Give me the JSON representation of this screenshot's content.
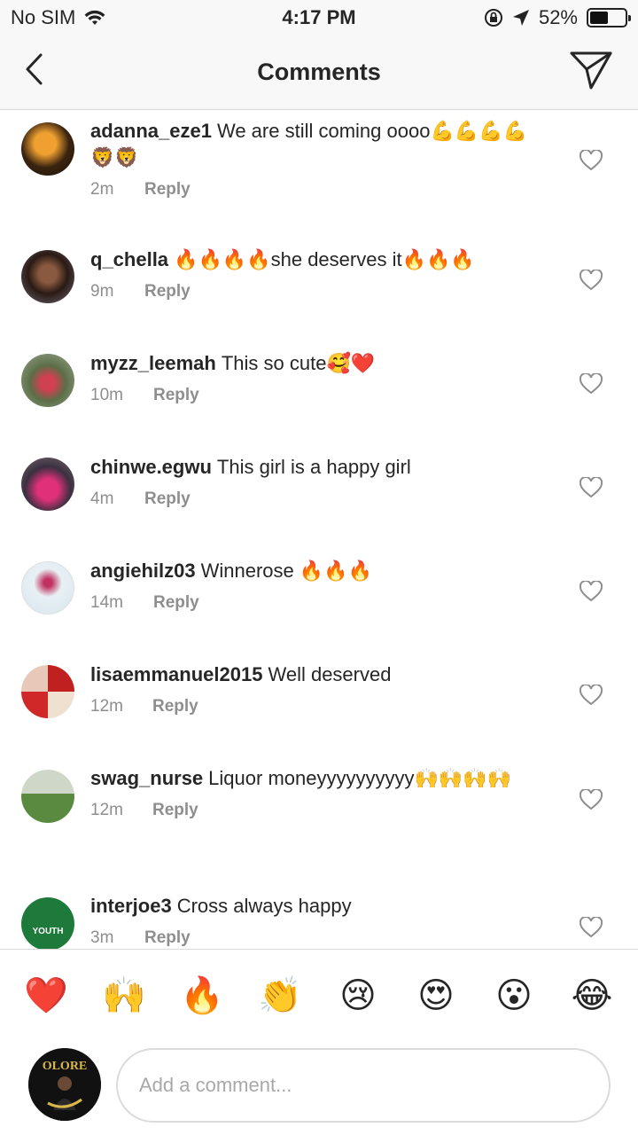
{
  "status_bar": {
    "carrier": "No SIM",
    "time": "4:17 PM",
    "battery_pct": "52%",
    "battery_level": 0.52,
    "icons": [
      "wifi-icon",
      "orientation-lock-icon",
      "location-arrow-icon",
      "battery-icon"
    ]
  },
  "header": {
    "title": "Comments",
    "back_icon": "chevron-left-icon",
    "send_icon": "paper-plane-icon"
  },
  "comments": [
    {
      "user": "adanna_eze1",
      "text": "We are still coming oooo💪💪💪💪🦁🦁",
      "time": "2m",
      "reply": "Reply"
    },
    {
      "user": "q_chella",
      "text": "🔥🔥🔥🔥she deserves it🔥🔥🔥",
      "time": "9m",
      "reply": "Reply"
    },
    {
      "user": "myzz_leemah",
      "text": "This so cute🥰❤️",
      "time": "10m",
      "reply": "Reply"
    },
    {
      "user": "chinwe.egwu",
      "text": "This girl is a happy girl",
      "time": "4m",
      "reply": "Reply"
    },
    {
      "user": "angiehilz03",
      "text": "Winnerose 🔥🔥🔥",
      "time": "14m",
      "reply": "Reply"
    },
    {
      "user": "lisaemmanuel2015",
      "text": "Well deserved",
      "time": "12m",
      "reply": "Reply"
    },
    {
      "user": "swag_nurse",
      "text": "Liquor moneyyyyyyyyyy🙌🙌🙌🙌",
      "time": "12m",
      "reply": "Reply"
    },
    {
      "user": "interjoe3",
      "text": "Cross always happy",
      "time": "3m",
      "reply": "Reply"
    }
  ],
  "emoji_bar": [
    "❤️",
    "🙌",
    "🔥",
    "👏",
    "😢",
    "😍",
    "😮",
    "😂"
  ],
  "composer": {
    "placeholder": "Add a comment...",
    "avatar_text": "OLORE"
  },
  "avatar_badge": {
    "text": "YOUTH"
  },
  "colors": {
    "text": "#262626",
    "muted": "#8e8e8e",
    "divider": "#dbdbdb",
    "header_bg": "#f8f8f8"
  }
}
